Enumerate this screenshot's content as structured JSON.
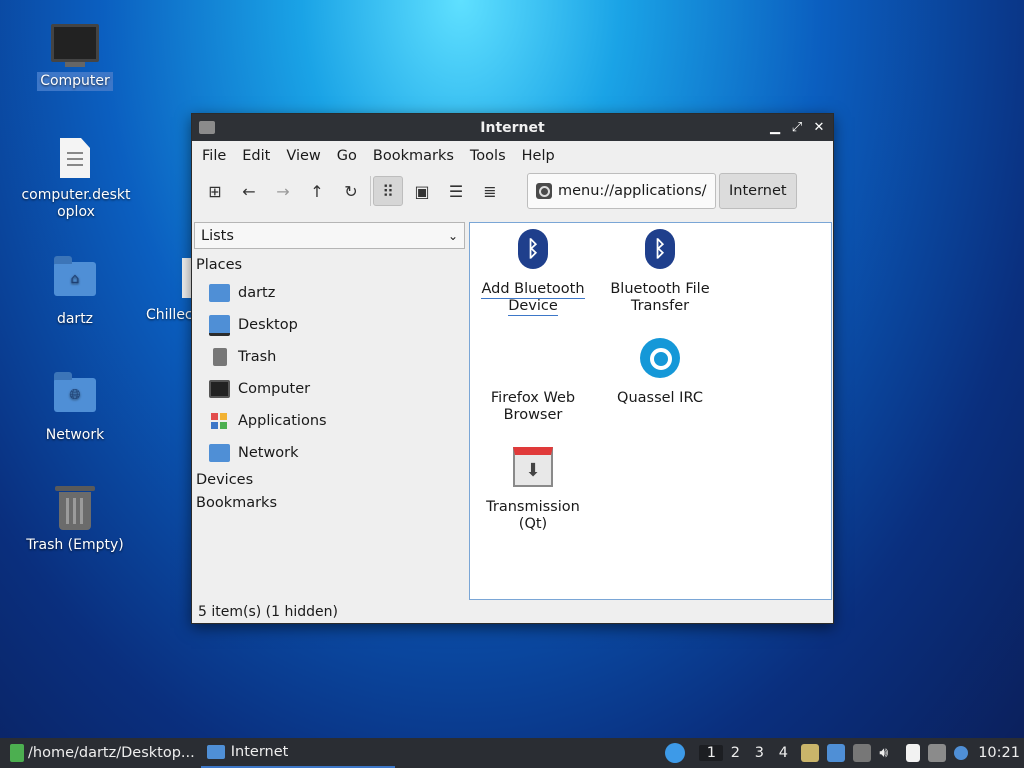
{
  "desktop": {
    "icons": [
      {
        "label": "Computer"
      },
      {
        "label": "computer.desktoplox"
      },
      {
        "label": "dartz"
      },
      {
        "label": "Chillec"
      },
      {
        "label": "Network"
      },
      {
        "label": "Trash (Empty)"
      }
    ]
  },
  "window": {
    "title": "Internet",
    "menu": [
      "File",
      "Edit",
      "View",
      "Go",
      "Bookmarks",
      "Tools",
      "Help"
    ],
    "path": "menu://applications/",
    "breadcrumb": "Internet",
    "side_mode": "Lists",
    "sections": {
      "places": "Places",
      "devices": "Devices",
      "bookmarks": "Bookmarks"
    },
    "places": [
      {
        "label": "dartz",
        "icon": "home-folder-icon"
      },
      {
        "label": "Desktop",
        "icon": "desktop-icon"
      },
      {
        "label": "Trash",
        "icon": "trash-icon"
      },
      {
        "label": "Computer",
        "icon": "computer-icon"
      },
      {
        "label": "Applications",
        "icon": "applications-icon"
      },
      {
        "label": "Network",
        "icon": "network-folder-icon"
      }
    ],
    "items": [
      {
        "label": "Add Bluetooth Device",
        "icon": "bluetooth-icon"
      },
      {
        "label": "Bluetooth File Transfer",
        "icon": "bluetooth-icon"
      },
      {
        "label": "Firefox Web Browser",
        "icon": "firefox-icon"
      },
      {
        "label": "Quassel IRC",
        "icon": "quassel-icon"
      },
      {
        "label": "Transmission (Qt)",
        "icon": "transmission-icon"
      }
    ],
    "status": "5 item(s) (1 hidden)"
  },
  "taskbar": {
    "tasks": [
      "/home/dartz/Desktop...",
      "Internet"
    ],
    "workspaces": [
      "1",
      "2",
      "3",
      "4"
    ],
    "clock": "10:21"
  }
}
